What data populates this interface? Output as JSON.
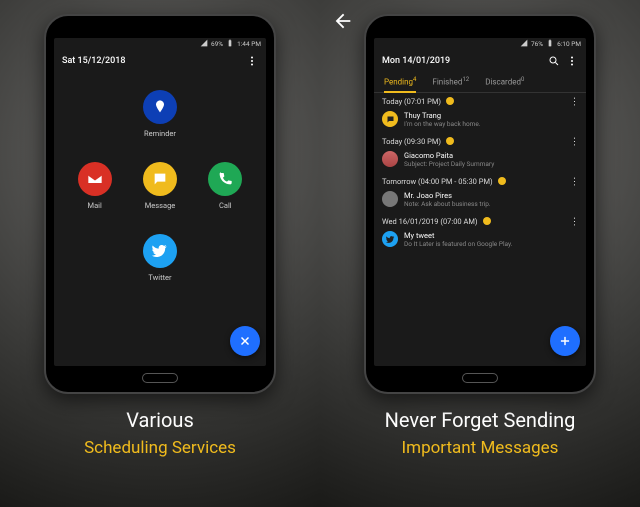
{
  "left": {
    "status": {
      "battery": "69%",
      "time": "1:44 PM"
    },
    "date": "Sat 15/12/2018",
    "services": {
      "reminder": "Reminder",
      "mail": "Mail",
      "message": "Message",
      "call": "Call",
      "twitter": "Twitter"
    },
    "caption1": "Various",
    "caption2": "Scheduling Services"
  },
  "right": {
    "status": {
      "battery": "76%",
      "time": "6:10 PM"
    },
    "date": "Mon 14/01/2019",
    "tabs": {
      "pending": {
        "label": "Pending",
        "count": "4"
      },
      "finished": {
        "label": "Finished",
        "count": "12"
      },
      "discarded": {
        "label": "Discarded",
        "count": "0"
      }
    },
    "sections": [
      {
        "header": "Today (07:01 PM)",
        "item": {
          "title": "Thuy Trang",
          "sub": "I'm on the way back home."
        }
      },
      {
        "header": "Today (09:30 PM)",
        "item": {
          "title": "Giacomo Paita",
          "sub": "Subject: Project Daily Summary"
        }
      },
      {
        "header": "Tomorrow (04:00 PM - 05:30 PM)",
        "item": {
          "title": "Mr. Joao Pires",
          "sub": "Note: Ask about business trip."
        }
      },
      {
        "header": "Wed 16/01/2019 (07:00 AM)",
        "item": {
          "title": "My tweet",
          "sub": "Do It Later is featured on Google Play."
        }
      }
    ],
    "caption1": "Never Forget Sending",
    "caption2": "Important Messages"
  }
}
